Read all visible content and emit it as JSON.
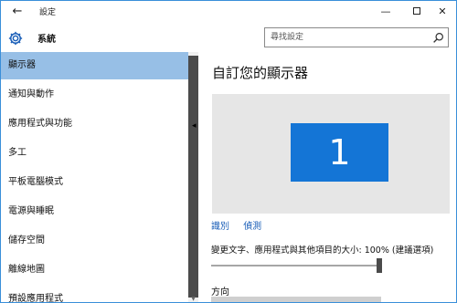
{
  "window": {
    "title": "設定",
    "back_icon": "arrow-left-icon",
    "controls": {
      "minimize": "—",
      "close": "✕"
    }
  },
  "header": {
    "section_title": "系統",
    "search_placeholder": "尋找設定"
  },
  "sidebar": {
    "items": [
      {
        "label": "顯示器",
        "active": true
      },
      {
        "label": "通知與動作",
        "active": false
      },
      {
        "label": "應用程式與功能",
        "active": false
      },
      {
        "label": "多工",
        "active": false
      },
      {
        "label": "平板電腦模式",
        "active": false
      },
      {
        "label": "電源與睡眠",
        "active": false
      },
      {
        "label": "儲存空間",
        "active": false
      },
      {
        "label": "離線地圖",
        "active": false
      },
      {
        "label": "預設應用程式",
        "active": false
      }
    ]
  },
  "main": {
    "title": "自訂您的顯示器",
    "monitor_number": "1",
    "identify_link": "識別",
    "detect_link": "偵測",
    "scale_label": "變更文字、應用程式與其他項目的大小: 100% (建議選項)",
    "scale_value_percent": 100,
    "orientation_label": "方向"
  },
  "colors": {
    "accent": "#1475d6",
    "active_nav": "#97bfe6",
    "link": "#1b5fb8",
    "panel_bg": "#e6e6e6"
  }
}
